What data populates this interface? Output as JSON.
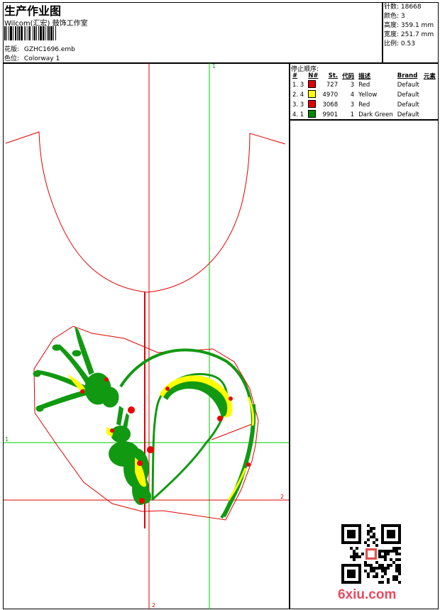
{
  "header": {
    "title": "生产作业图",
    "company": "Wilcom(汇宏) 鼓饰工作室",
    "design_label": "花版:",
    "design_value": "GZHC1696.emb",
    "colorway_label": "色位:",
    "colorway_value": "Colorway 1"
  },
  "stats": [
    {
      "label": "针数:",
      "value": "18668"
    },
    {
      "label": "颜色:",
      "value": "3"
    },
    {
      "label": "高度:",
      "value": "359.1 mm"
    },
    {
      "label": "宽度:",
      "value": "251.7 mm"
    },
    {
      "label": "比例:",
      "value": "0.53"
    }
  ],
  "stop_sequence": {
    "title": "停止顺序:",
    "headers": [
      "#",
      "N#",
      "St.",
      "代码",
      "描述",
      "Brand",
      "元素"
    ],
    "rows": [
      {
        "index": "1. 3",
        "stitches": "727",
        "code": "3",
        "desc": "Red",
        "brand": "Default",
        "color": "#e00000"
      },
      {
        "index": "2. 4",
        "stitches": "4970",
        "code": "4",
        "desc": "Yellow",
        "brand": "Default",
        "color": "#ffff00"
      },
      {
        "index": "3. 3",
        "stitches": "3068",
        "code": "3",
        "desc": "Red",
        "brand": "Default",
        "color": "#e00000"
      },
      {
        "index": "4. 1",
        "stitches": "9901",
        "code": "1",
        "desc": "Dark Green",
        "brand": "Default",
        "color": "#008800"
      }
    ]
  },
  "grid_labels": {
    "top": "1",
    "left": "1",
    "right": "2",
    "bottom": "2"
  },
  "watermark": "6xiu.com",
  "colors": {
    "outline_red": "#e00000",
    "guide_green": "#00cc00",
    "guide_red": "#e00000",
    "thread_green": "#119911",
    "thread_yellow": "#ffff00",
    "thread_red": "#ee0000"
  }
}
